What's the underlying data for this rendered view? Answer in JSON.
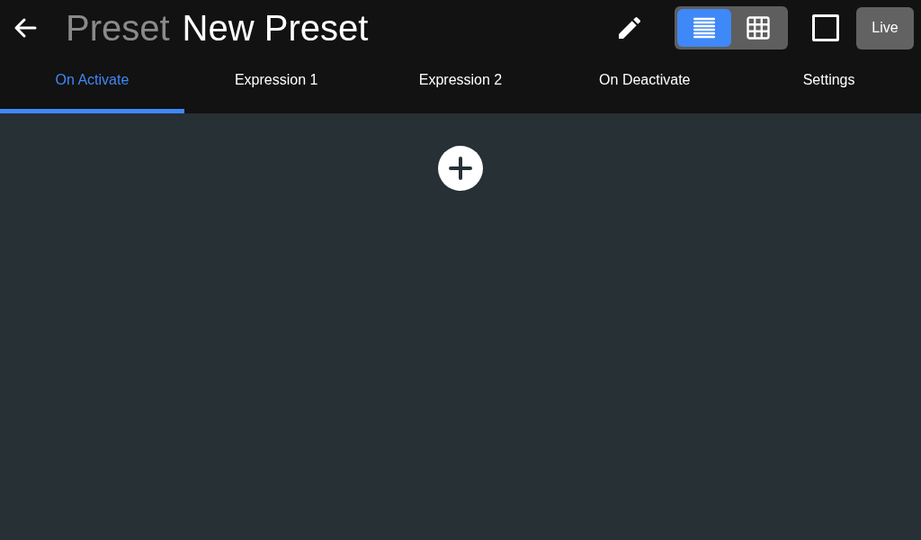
{
  "header": {
    "prefix": "Preset",
    "title": "New Preset",
    "live_button": "Live"
  },
  "view_toggle": [
    {
      "kind": "list",
      "selected": true
    },
    {
      "kind": "grid",
      "selected": false
    }
  ],
  "stop_toggle": {
    "checked": false
  },
  "tabs": [
    {
      "label": "On Activate",
      "selected": true
    },
    {
      "label": "Expression 1",
      "selected": false
    },
    {
      "label": "Expression 2",
      "selected": false
    },
    {
      "label": "On Deactivate",
      "selected": false
    },
    {
      "label": "Settings",
      "selected": false
    }
  ]
}
